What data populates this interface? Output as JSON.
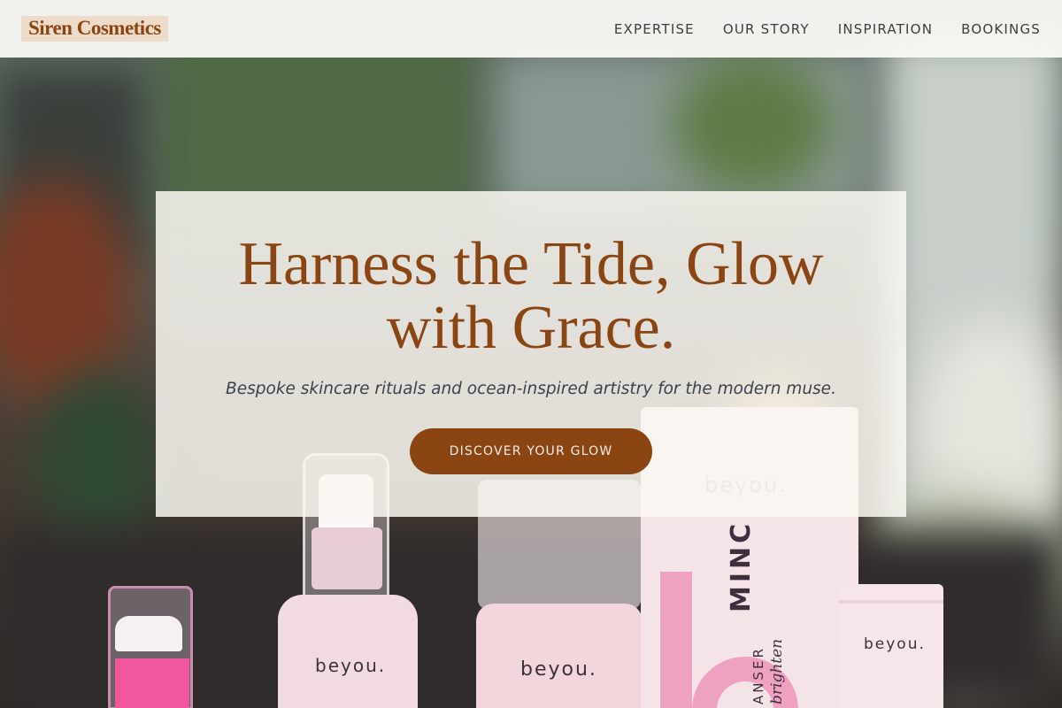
{
  "header": {
    "brand": "Siren Cosmetics",
    "nav": [
      "EXPERTISE",
      "OUR STORY",
      "INSPIRATION",
      "BOOKINGS"
    ]
  },
  "hero": {
    "title_line1": "Harness the Tide, Glow",
    "title_line2": "with Grace.",
    "subtitle": "Bespoke skincare rituals and ocean-inspired artistry for the modern muse.",
    "cta_label": "DISCOVER YOUR GLOW"
  },
  "products": {
    "brand_mark": "beyou.",
    "tube_text_big": "MINC",
    "tube_text_small": "ANSER",
    "tube_text_script": "brighten"
  },
  "colors": {
    "accent": "#8b4513",
    "logo_bg": "#ecdcc9",
    "header_bg": "#f8f7f2",
    "card_bg": "#faf8f2",
    "subtitle": "#3b4250",
    "bottle_pink": "#f2dbe0",
    "hot_pink": "#f0579c"
  }
}
